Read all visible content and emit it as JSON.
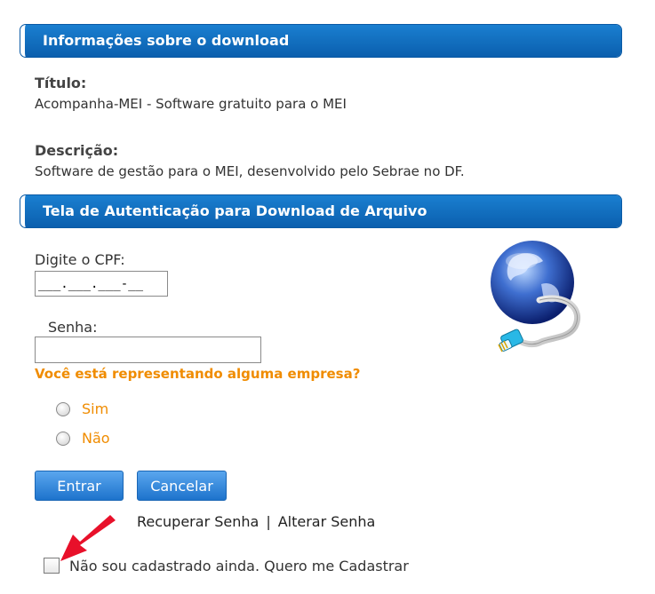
{
  "download_info": {
    "header": "Informações sobre o download",
    "title_label": "Título:",
    "title_value": "Acompanha-MEI - Software gratuito para o MEI",
    "description_label": "Descrição:",
    "description_value": "Software de gestão para o MEI, desenvolvido pelo Sebrae no DF."
  },
  "auth": {
    "header": "Tela de Autenticação para Download de Arquivo",
    "cpf_label": "Digite o CPF:",
    "cpf_value": "___.___.___-__",
    "password_label": "Senha:",
    "password_value": "",
    "question": "Você está representando alguma empresa?",
    "options": [
      "Sim",
      "Não"
    ],
    "enter_button": "Entrar",
    "cancel_button": "Cancelar",
    "recover_link": "Recuperar Senha",
    "link_separator": "|",
    "change_link": "Alterar Senha",
    "register_checkbox_label": "Não sou cadastrado ainda. Quero me Cadastrar"
  },
  "colors": {
    "header_blue": "#0b6cc0",
    "accent_orange": "#f08c00",
    "arrow_red": "#e8102a"
  },
  "icons": {
    "globe": "globe-network-icon",
    "arrow": "red-arrow-icon"
  }
}
